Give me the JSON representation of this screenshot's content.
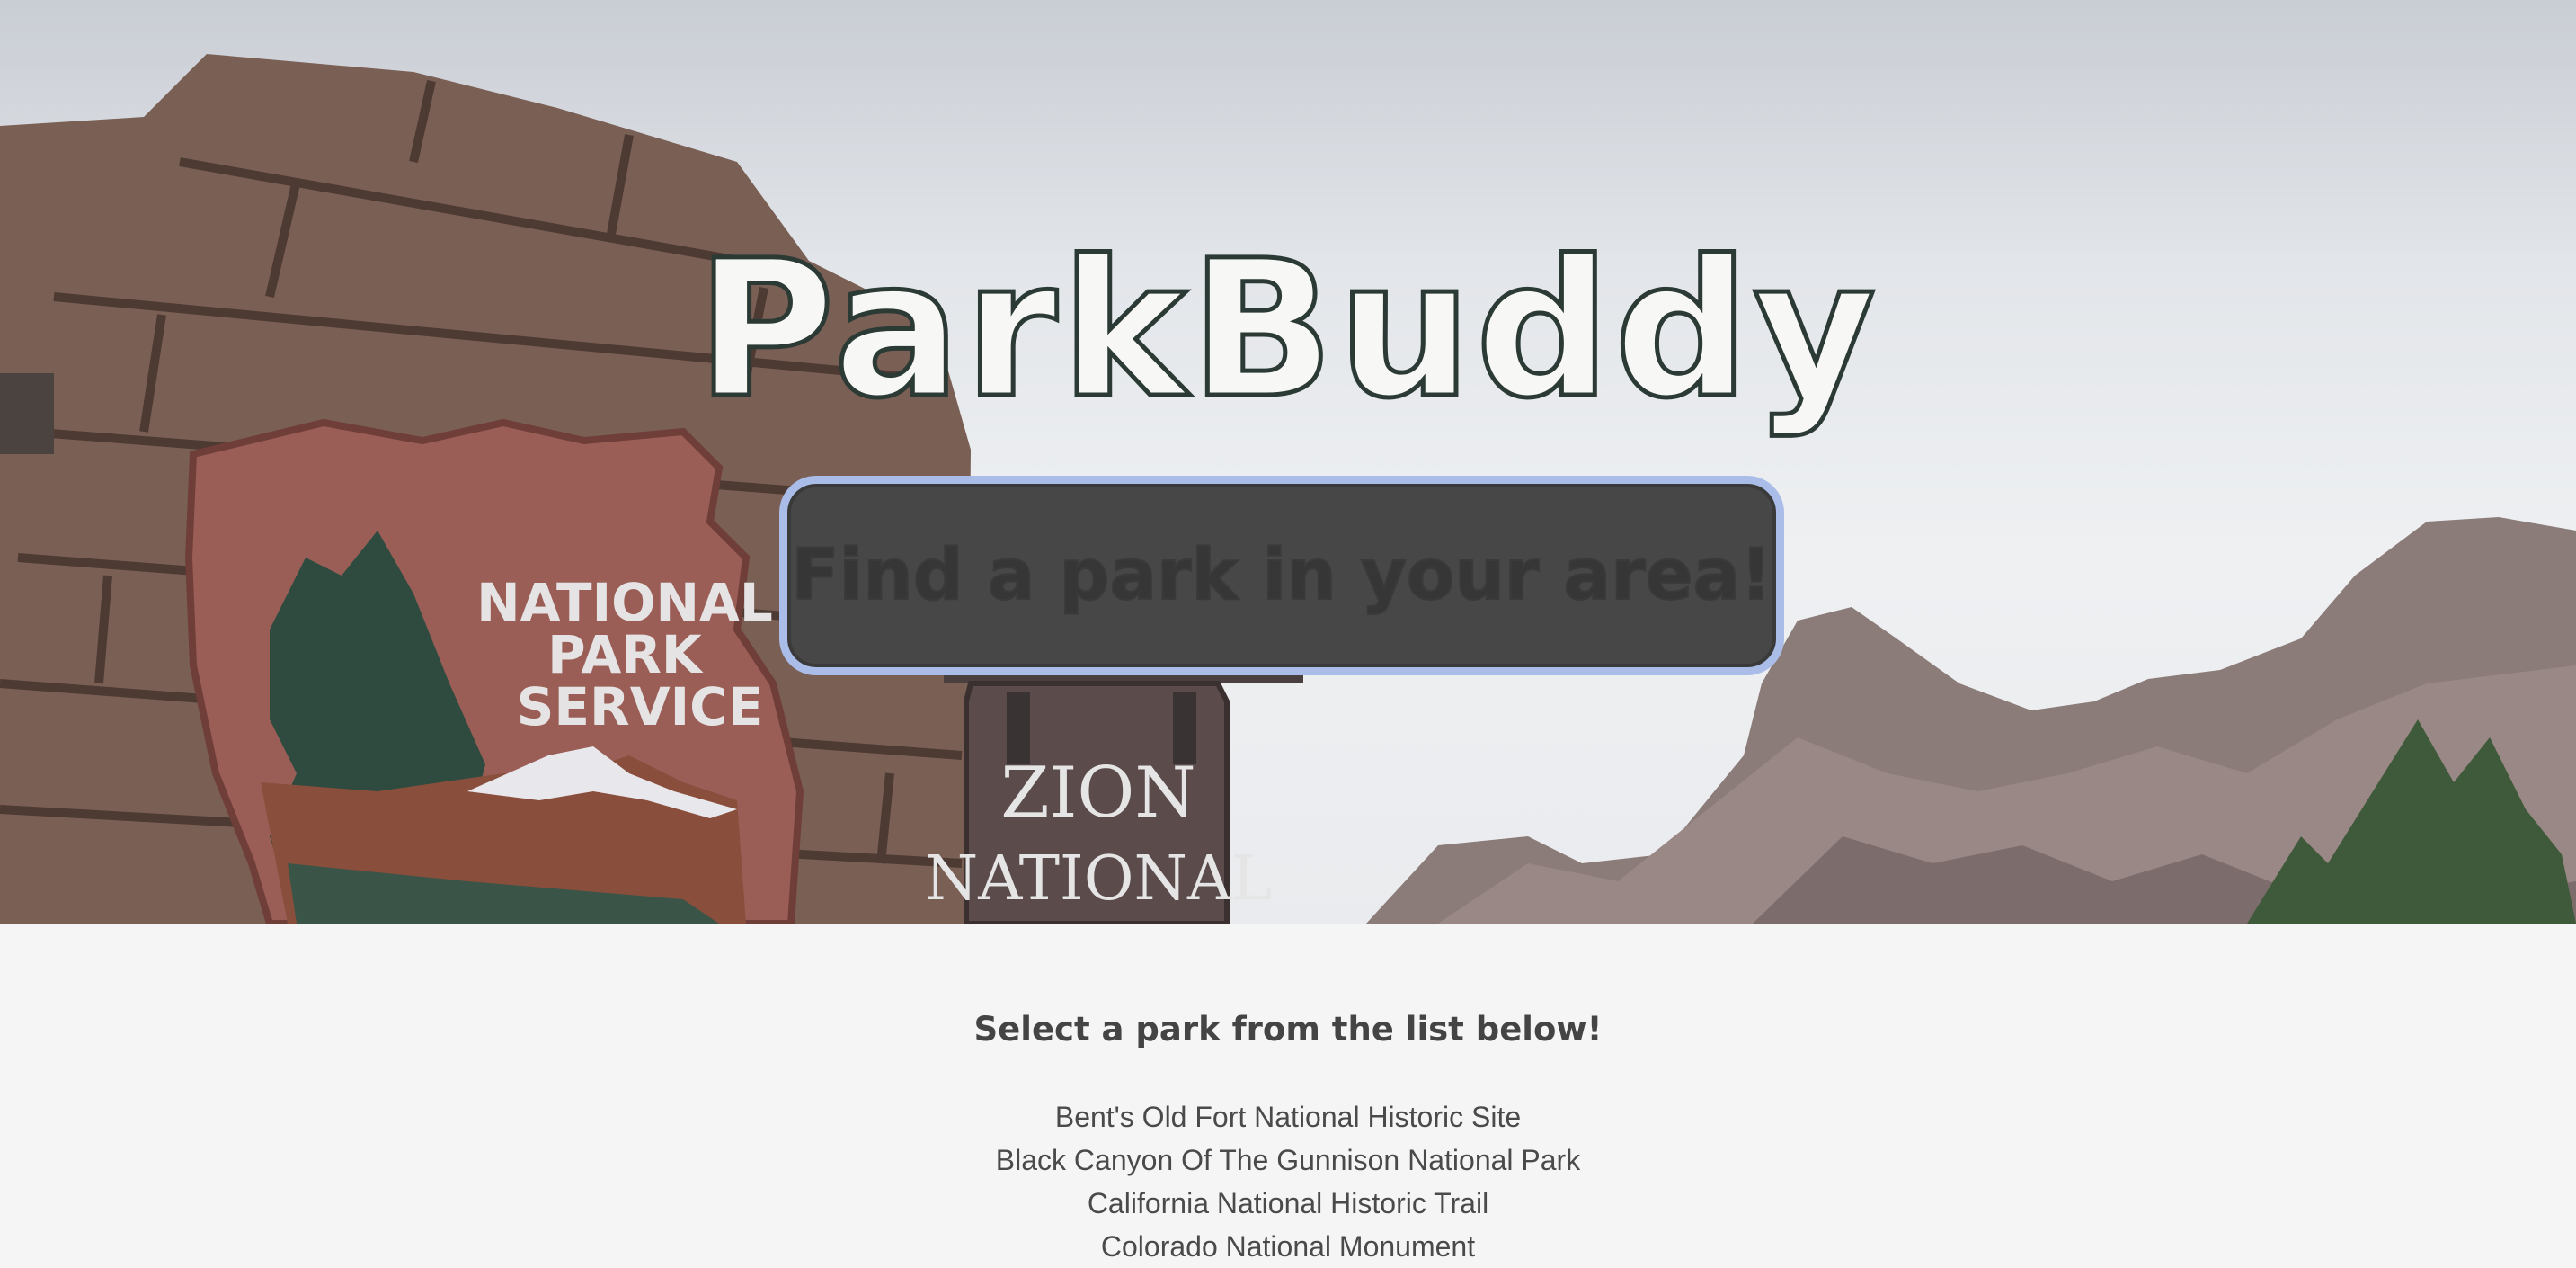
{
  "hero": {
    "title": "ParkBuddy",
    "find_button_label": "Find a park in your area!",
    "sign_emblem_text": [
      "NATIONAL",
      "PARK",
      "SERVICE"
    ],
    "sign_park_text": [
      "ZION",
      "NATIONAL"
    ]
  },
  "main": {
    "subtitle": "Select a park from the list below!",
    "parks": [
      "Bent's Old Fort National Historic Site",
      "Black Canyon Of The Gunnison National Park",
      "California National Historic Trail",
      "Colorado National Monument"
    ]
  },
  "colors": {
    "page_background": "#f5f5f5",
    "button_background": "#474747",
    "button_focus_ring": "#aabde8",
    "title_outline": "#2b3a35"
  }
}
